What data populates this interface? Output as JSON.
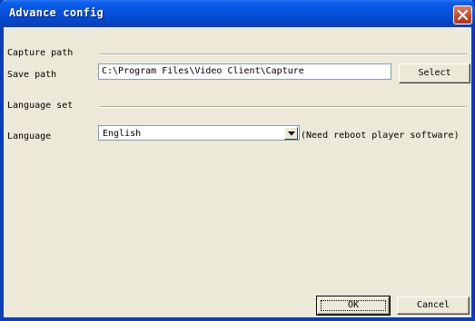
{
  "window": {
    "title": "Advance config",
    "close_icon": "close-icon"
  },
  "capture": {
    "group_label": "Capture path",
    "save_path_label": "Save path",
    "save_path_value": "C:\\Program Files\\Video Client\\Capture",
    "select_button": "Select"
  },
  "language": {
    "group_label": "Language set",
    "language_label": "Language",
    "selected_value": "English",
    "note": "(Need reboot player software)"
  },
  "footer": {
    "ok_button": "OK",
    "cancel_button": "Cancel"
  },
  "colors": {
    "titlebar": "#0651df",
    "dialog_bg": "#ece9d8",
    "close_button": "#c8432a"
  }
}
